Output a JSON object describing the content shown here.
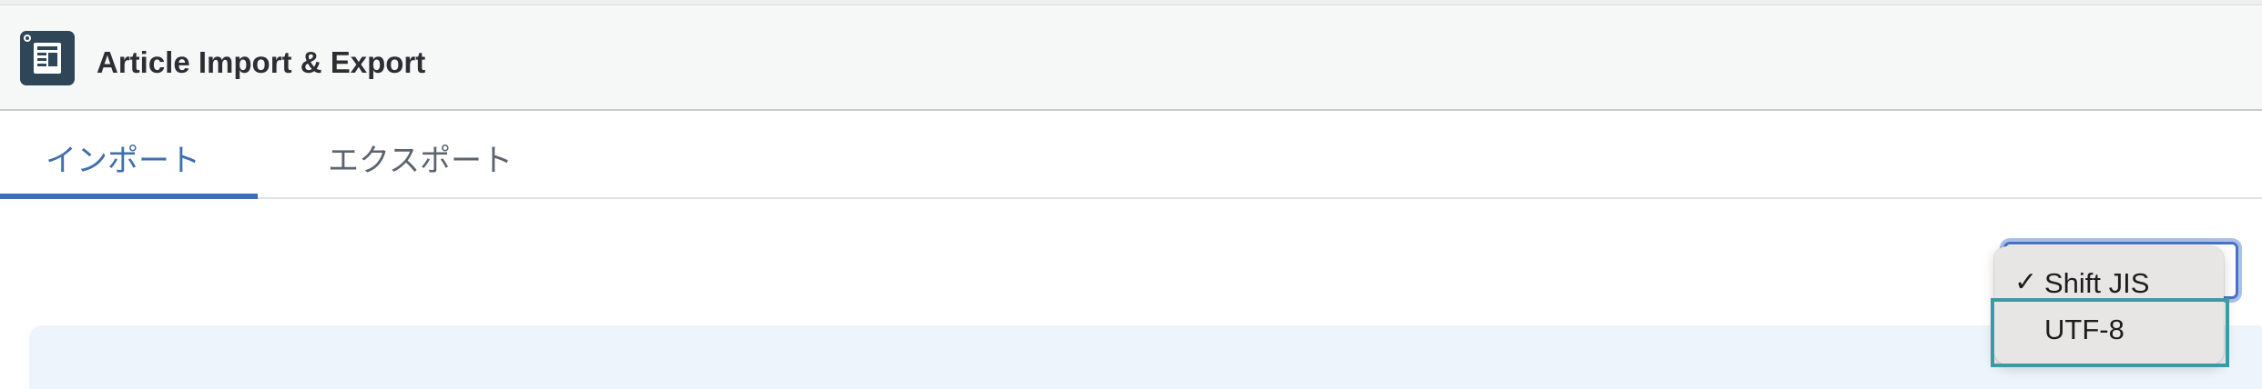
{
  "header": {
    "title": "Article Import & Export",
    "icon": "newspaper-app-icon"
  },
  "tabs": [
    {
      "label": "インポート",
      "selected": true
    },
    {
      "label": "エクスポート",
      "selected": false
    }
  ],
  "encoding_select": {
    "options": [
      {
        "label": "Shift JIS",
        "checked": true,
        "check_mark": "✓"
      },
      {
        "label": "UTF-8",
        "checked": false,
        "check_mark": ""
      }
    ],
    "selected_value": "Shift JIS"
  },
  "colors": {
    "accent": "#3a70b3",
    "header_bg": "#f6f8f8",
    "app_icon_bg": "#2f4658",
    "info_panel_bg": "#edf4fb",
    "menu_bg": "#e8e6e4",
    "highlight": "#3b9aa3"
  }
}
